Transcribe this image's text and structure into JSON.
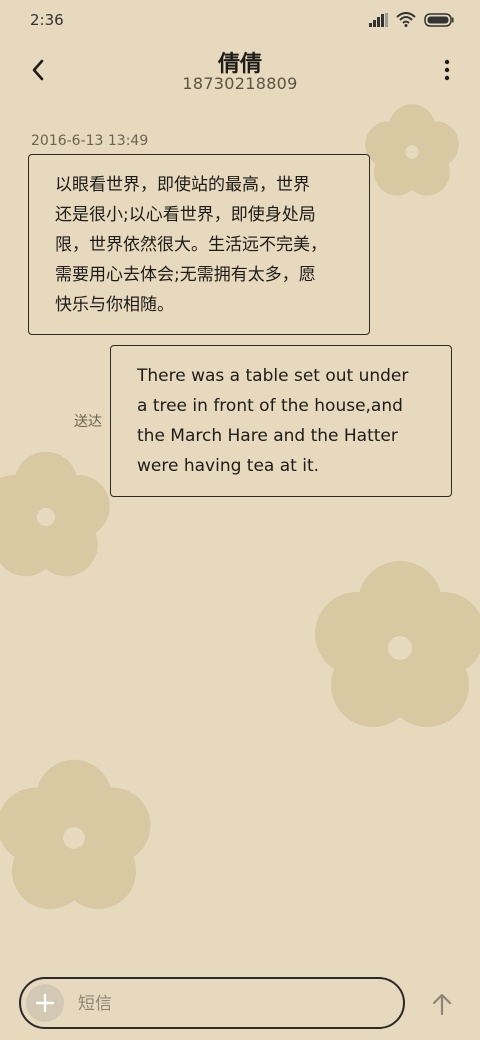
{
  "status_bar": {
    "time": "2:36",
    "icons": [
      "signal-icon",
      "wifi-icon",
      "battery-icon"
    ]
  },
  "header": {
    "contact_name": "倩倩",
    "contact_number": "18730218809",
    "back_icon": "chevron-left-icon",
    "more_icon": "more-vertical-icon"
  },
  "conversation": {
    "timestamp": "2016-6-13 13:49",
    "received_message": {
      "lines": [
        "以眼看世界，即使站的最高，世界",
        "还是很小;以心看世界，即使身处局",
        "限，世界依然很大。生活远不完美，",
        "需要用心去体会;无需拥有太多，愿",
        "快乐与你相随。"
      ]
    },
    "sent_message": {
      "lines": [
        "There was a table set out under",
        "a tree in front of the house,and",
        "the March Hare and the Hatter",
        "were having tea at it."
      ],
      "status": "送达"
    }
  },
  "composer": {
    "placeholder": "短信",
    "value": "",
    "add_icon": "plus-icon",
    "send_icon": "arrow-up-icon"
  },
  "colors": {
    "background": "#e6d9bd",
    "flower": "#d9c9a3",
    "border": "#2c2a26",
    "text": "#1e1c18"
  }
}
